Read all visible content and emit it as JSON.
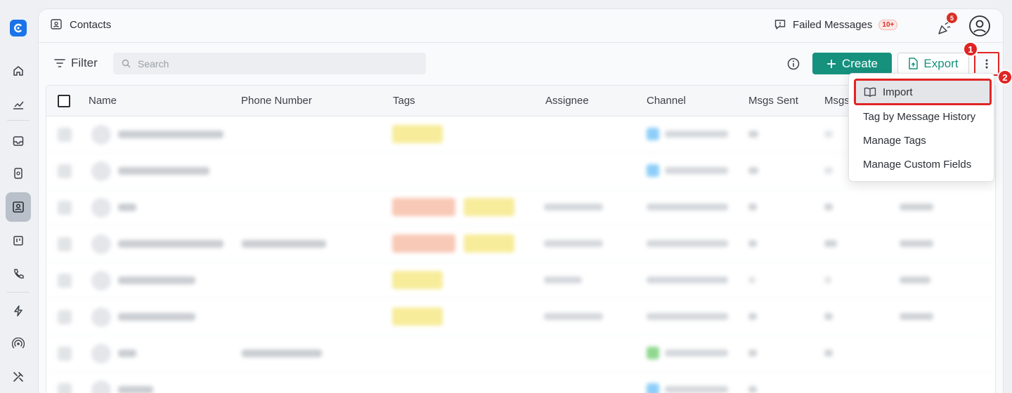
{
  "header": {
    "title": "Contacts",
    "failed_messages_label": "Failed Messages",
    "failed_messages_badge": "10+",
    "notification_count": "5"
  },
  "toolbar": {
    "filter_label": "Filter",
    "search_placeholder": "Search",
    "create_label": "Create",
    "export_label": "Export"
  },
  "table": {
    "columns": [
      "Name",
      "Phone Number",
      "Tags",
      "Assignee",
      "Channel",
      "Msgs Sent",
      "Msgs"
    ]
  },
  "menu": {
    "items": [
      "Import",
      "Tag by Message History",
      "Manage Tags",
      "Manage Custom Fields"
    ]
  },
  "annotations": [
    "1",
    "2"
  ],
  "colors": {
    "primary": "#16917e",
    "highlight": "#e02424",
    "brand": "#1a73e8"
  }
}
